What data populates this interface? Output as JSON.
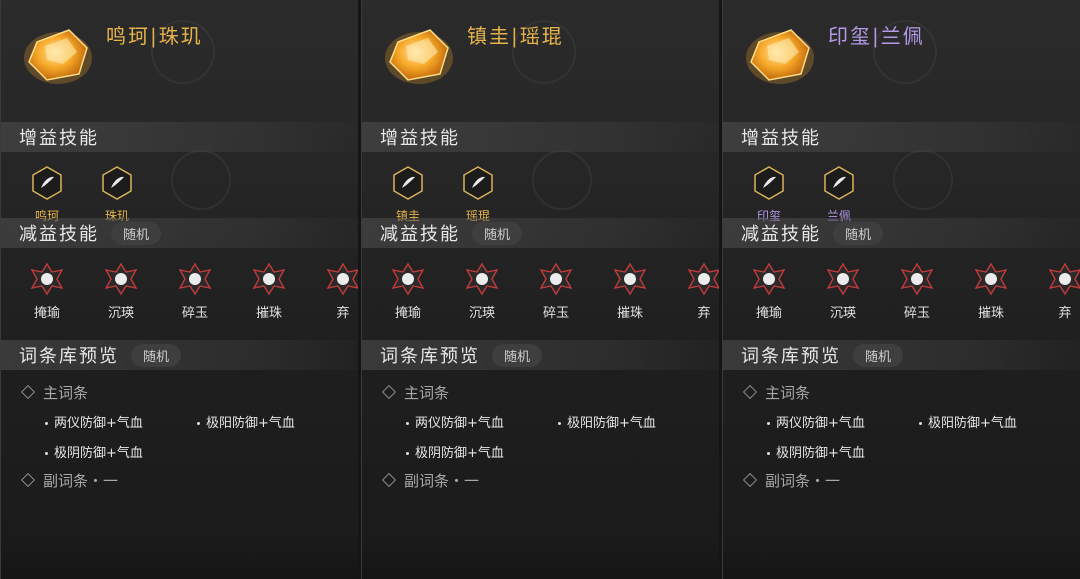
{
  "panels": [
    {
      "title": "鸣珂|珠玑",
      "title_color": "#e6b34a",
      "buff_section": "增益技能",
      "buffs": [
        {
          "label": "鸣珂",
          "icon": "swirl-icon"
        },
        {
          "label": "珠玑",
          "icon": "feather-icon"
        }
      ],
      "buff_color": "#e6b34a",
      "debuff_section": "减益技能",
      "debuff_tag": "随机",
      "debuffs": [
        {
          "label": "掩瑜"
        },
        {
          "label": "沉瑛"
        },
        {
          "label": "碎玉"
        },
        {
          "label": "摧珠"
        },
        {
          "label": "弃"
        }
      ],
      "library_section": "词条库预览",
      "library_tag": "随机",
      "main_affix_title": "主词条",
      "main_affixes": [
        "两仪防御+气血",
        "极阳防御+气血",
        "极阴防御+气血"
      ],
      "sub_affix_title": "副词条・一"
    },
    {
      "title": "镇圭|瑶琨",
      "title_color": "#e6b34a",
      "buff_section": "增益技能",
      "buffs": [
        {
          "label": "镇圭",
          "icon": "tower-icon"
        },
        {
          "label": "瑶琨",
          "icon": "shield-icon"
        }
      ],
      "buff_color": "#e6b34a",
      "debuff_section": "减益技能",
      "debuff_tag": "随机",
      "debuffs": [
        {
          "label": "掩瑜"
        },
        {
          "label": "沉瑛"
        },
        {
          "label": "碎玉"
        },
        {
          "label": "摧珠"
        },
        {
          "label": "弃"
        }
      ],
      "library_section": "词条库预览",
      "library_tag": "随机",
      "main_affix_title": "主词条",
      "main_affixes": [
        "两仪防御+气血",
        "极阳防御+气血",
        "极阴防御+气血"
      ],
      "sub_affix_title": "副词条・一"
    },
    {
      "title": "印玺|兰佩",
      "title_color": "#b49ae8",
      "buff_section": "增益技能",
      "buffs": [
        {
          "label": "印玺",
          "icon": "sword-icon"
        },
        {
          "label": "兰佩",
          "icon": "flower-icon"
        }
      ],
      "buff_color": "#b49ae8",
      "debuff_section": "减益技能",
      "debuff_tag": "随机",
      "debuffs": [
        {
          "label": "掩瑜"
        },
        {
          "label": "沉瑛"
        },
        {
          "label": "碎玉"
        },
        {
          "label": "摧珠"
        },
        {
          "label": "弃"
        }
      ],
      "library_section": "词条库预览",
      "library_tag": "随机",
      "main_affix_title": "主词条",
      "main_affixes": [
        "两仪防御+气血",
        "极阳防御+气血",
        "极阴防御+气血"
      ],
      "sub_affix_title": "副词条・一"
    }
  ]
}
